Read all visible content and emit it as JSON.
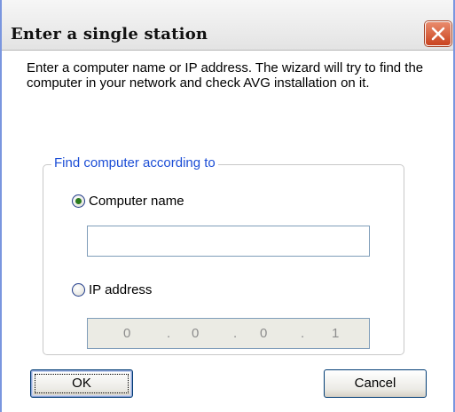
{
  "dialog": {
    "title": "Enter a single station",
    "description": "Enter a computer name or IP address. The wizard will try to find the computer in your network and check AVG installation on it.",
    "close_icon": "close-icon"
  },
  "group": {
    "legend": "Find computer according to",
    "options": [
      {
        "label": "Computer name",
        "checked": true
      },
      {
        "label": "IP address",
        "checked": false
      }
    ],
    "computer_name_value": "",
    "ip_address": {
      "octets": [
        "0",
        "0",
        "0",
        "1"
      ],
      "separator": ".",
      "disabled": true
    }
  },
  "buttons": {
    "ok_label": "OK",
    "cancel_label": "Cancel"
  },
  "colors": {
    "legend": "#1c4ed6",
    "close_button": "#c9431f",
    "disabled_field": "#ebebe4"
  }
}
